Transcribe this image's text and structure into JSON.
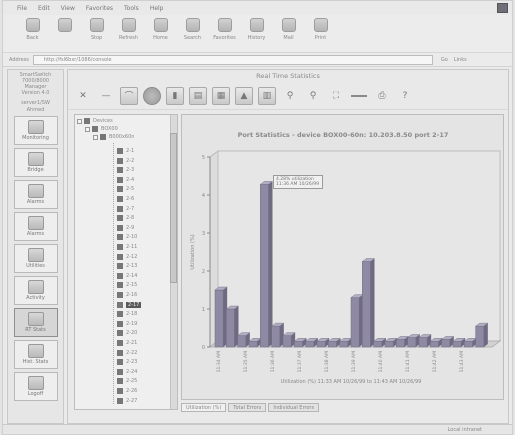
{
  "menu": [
    "File",
    "Edit",
    "View",
    "Favorites",
    "Tools",
    "Help"
  ],
  "browser_toolbar": [
    {
      "label": "Back",
      "icon": "back-icon"
    },
    {
      "label": "",
      "icon": "forward-icon"
    },
    {
      "label": "Stop",
      "icon": "stop-icon"
    },
    {
      "label": "Refresh",
      "icon": "refresh-icon"
    },
    {
      "label": "Home",
      "icon": "home-icon"
    },
    {
      "label": "Search",
      "icon": "search-icon"
    },
    {
      "label": "Favorites",
      "icon": "favorites-icon"
    },
    {
      "label": "History",
      "icon": "history-icon"
    },
    {
      "label": "Mail",
      "icon": "mail-icon"
    },
    {
      "label": "Print",
      "icon": "print-icon"
    }
  ],
  "address": {
    "label": "Address",
    "url": "http://fsl6bxr/1086/console",
    "go": "Go",
    "links": "Links"
  },
  "leftnav": {
    "title_lines": [
      "SmartSwitch",
      "7000/8000",
      "Manager",
      "Version 4.0"
    ],
    "sub": "server1/SW",
    "sub2": "Ahmed",
    "buttons": [
      {
        "label": "Monitoring",
        "icon": "monitoring-icon"
      },
      {
        "label": "Bridge",
        "icon": "bridge-icon"
      },
      {
        "label": "Alarms",
        "icon": "alarms-icon"
      },
      {
        "label": "Alarms",
        "icon": "alarms-icon"
      },
      {
        "label": "Utilities",
        "icon": "utilities-icon"
      },
      {
        "label": "Activity",
        "icon": "activity-icon"
      },
      {
        "label": "RT Stats",
        "icon": "rt-stats-icon",
        "selected": true
      },
      {
        "label": "Hist. Stats",
        "icon": "hist-stats-icon"
      },
      {
        "label": "Logoff",
        "icon": "logoff-icon"
      }
    ]
  },
  "main_title": "Real Time Statistics",
  "tree": {
    "root": "Devices",
    "device": "BOX00",
    "sub": "B000x60n",
    "ports": [
      "2-1",
      "2-2",
      "2-3",
      "2-4",
      "2-5",
      "2-6",
      "2-7",
      "2-8",
      "2-9",
      "2-10",
      "2-11",
      "2-12",
      "2-13",
      "2-14",
      "2-15",
      "2-16",
      "2-17",
      "2-18",
      "2-19",
      "2-20",
      "2-21",
      "2-22",
      "2-23",
      "2-24",
      "2-25",
      "2-26",
      "2-27"
    ],
    "selected_index": 16
  },
  "tooltip": {
    "line1": "4.28% utilization",
    "line2": "11:36 AM 10/26/99"
  },
  "tabs": [
    "Utilization (%)",
    "Total Errors",
    "Individual Errors"
  ],
  "status": {
    "zone": "Local intranet"
  },
  "chart_data": {
    "type": "bar",
    "title": "Port Statistics - device BOX00-60n: 10.203.8.50 port 2-17",
    "ylabel": "Utilization (%)",
    "xlabel": "Utilization (%) 11:33 AM 10/26/99 to 11:43 AM 10/26/99",
    "ylim": [
      0,
      5
    ],
    "yticks": [
      0,
      1,
      2,
      3,
      4,
      5
    ],
    "categories": [
      "11:34 AM",
      "11:35 AM",
      "11:36 AM",
      "11:37 AM",
      "11:38 AM",
      "11:39 AM",
      "11:40 AM",
      "11:41 AM",
      "11:42 AM",
      "11:43 AM"
    ],
    "values": [
      1.5,
      1.0,
      0.3,
      0.15,
      4.28,
      0.55,
      0.3,
      0.15,
      0.15,
      0.15,
      0.15,
      0.15,
      1.3,
      2.25,
      0.15,
      0.15,
      0.2,
      0.25,
      0.25,
      0.15,
      0.2,
      0.15,
      0.15,
      0.55
    ],
    "grid": false,
    "color": "#8f8aa3"
  }
}
